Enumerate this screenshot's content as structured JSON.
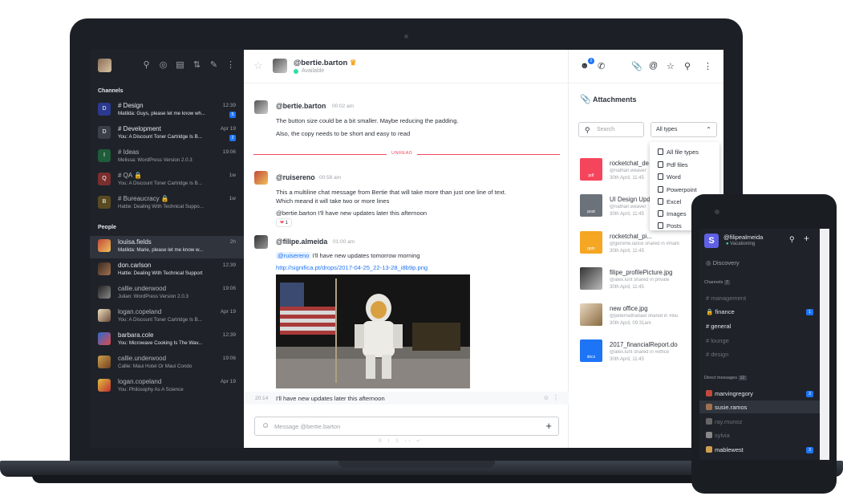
{
  "colors": {
    "accent": "#1d74f5",
    "sidebar_bg": "#1f2329",
    "unread": "#f5455c",
    "online": "#2de0a5"
  },
  "sidebar": {
    "channels_label": "Channels",
    "people_label": "People",
    "channels": [
      {
        "name": "Design",
        "initial": "D",
        "message": "Matilda: Guys, please let me know wh...",
        "time": "12:39",
        "badge": "5",
        "color": "#2b3a8f"
      },
      {
        "name": "Development",
        "initial": "D",
        "message": "You: A Discount Toner Cartridge Is B...",
        "time": "Apr 19",
        "badge": "2",
        "color": "#3b4048"
      },
      {
        "name": "Ideas",
        "initial": "I",
        "message": "Melissa: WordPress Version 2.0.3",
        "time": "19:06",
        "badge": "",
        "color": "#1f5c3a"
      },
      {
        "name": "QA",
        "initial": "Q",
        "message": "You: A Discount Toner Cartridge Is B...",
        "time": "1w",
        "badge": "",
        "color": "#7a2e2e"
      },
      {
        "name": "Bureaucracy",
        "initial": "B",
        "message": "Hattie: Dealing With Technical Suppo...",
        "time": "1w",
        "badge": "",
        "color": "#5a4a22"
      }
    ],
    "people": [
      {
        "name": "louisa.fields",
        "message": "Matilda: Marie, please let me know w...",
        "time": "2h"
      },
      {
        "name": "don.carlson",
        "message": "Hattie: Dealing With Technical Support",
        "time": "12:39"
      },
      {
        "name": "callie.underwood",
        "message": "Julian: WordPress Version 2.0.3",
        "time": "19:06"
      },
      {
        "name": "logan.copeland",
        "message": "You: A Discount Toner Cartridge Is B...",
        "time": "Apr 19"
      },
      {
        "name": "barbara.cole",
        "message": "You: Microwave Cooking Is The Wav...",
        "time": "12:39"
      },
      {
        "name": "callie.underwood",
        "message": "Callie: Maui Hotel Or Maui Condo",
        "time": "19:06"
      },
      {
        "name": "logan.copeland",
        "message": "You: Philosophy As A Science",
        "time": "Apr 19"
      }
    ]
  },
  "header": {
    "user": "@bertie.barton",
    "status": "Available",
    "notif_count": "2"
  },
  "messages": {
    "m1": {
      "user": "@bertie.barton",
      "time": "00:02 am",
      "line1": "The button size could be a bit smaller. Maybe reducing the padding.",
      "line2": "Also, the copy needs to be short and easy to read"
    },
    "unread": "UNREAD",
    "m2": {
      "user": "@ruisereno",
      "time": "00:58 am",
      "line1": "This a multiline chat message from Bertie that will take more than just one line of text.",
      "line2": "Which meand it will take two or more lines",
      "line3": "@bertie.barton I'll have new updates later this afternoon",
      "reaction_count": "1"
    },
    "m3": {
      "user": "@filipe.almeida",
      "time": "01:00 am",
      "mention": "@ruisereno",
      "text": "I'll have new updates tomorrow morning",
      "link": "http://significa.pt/drops/2017-04-25_22-13-28_i8b9p.png"
    },
    "last": {
      "time": "20:14",
      "text": "I'll have new updates later this afternoon"
    },
    "composer_placeholder": "Message @bertie.barton"
  },
  "attachments": {
    "title": "Attachments",
    "search_placeholder": "Search",
    "type_selected": "All types",
    "dropdown": [
      "All file types",
      "Pdf files",
      "Word",
      "Powerpoint",
      "Excel",
      "Images",
      "Posts"
    ],
    "files": [
      {
        "name": "rocketchat_de...",
        "user": "@nathan.weaver",
        "date": "30th April, 11:45",
        "type": "pdf",
        "color": "#f5455c"
      },
      {
        "name": "UI Design Upd...",
        "user": "@nathan.weaver",
        "date": "30th April, 11:45",
        "type": "post",
        "color": "#6c727a"
      },
      {
        "name": "rocketchat_pi...",
        "user": "@gerome.lance shared in #mark",
        "date": "30th April, 11:45",
        "type": "pptx",
        "color": "#f5a623"
      },
      {
        "name": "filipe_profilePicture.jpg",
        "user": "@alex.lunt shared in private",
        "date": "30th April, 11:45",
        "type": "",
        "color": "#8c7a66"
      },
      {
        "name": "new office.jpg",
        "user": "@peternathanael shared in #lou",
        "date": "30th April, 09:31am",
        "type": "",
        "color": "#b09470"
      },
      {
        "name": "2017_financialReport.docx",
        "user": "@alex.lunt shared in #office",
        "date": "30th April, 11:45",
        "type": "docx",
        "color": "#1d74f5"
      }
    ]
  },
  "phone": {
    "user": "@filipealmeida",
    "status": "Vacationing",
    "discovery": "Discovery",
    "channels_label": "Channels",
    "channels_count": "7",
    "channels": [
      "management",
      "finance",
      "general",
      "lounge",
      "design"
    ],
    "finance_badge": "1",
    "dm_label": "Direct messages",
    "dm_count": "12",
    "dms": [
      "marvingregory",
      "susie.ramos",
      "ray.munoz",
      "sylvia",
      "mablewest"
    ],
    "dm_badge1": "3",
    "dm_badge2": "3"
  }
}
